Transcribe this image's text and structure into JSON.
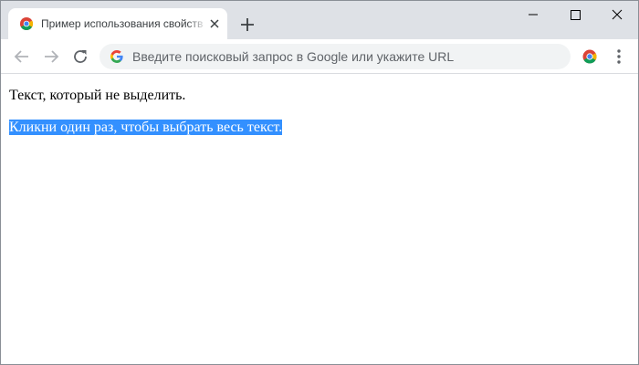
{
  "browser": {
    "tab": {
      "title": "Пример использования свойства user-select",
      "favicon": "chromium-favicon-icon"
    },
    "omnibox": {
      "placeholder": "Введите поисковый запрос в Google или укажите URL"
    },
    "colors": {
      "tabstrip": "#dee1e6",
      "omnibox_bg": "#f1f3f4",
      "selection": "#3390ff"
    }
  },
  "page": {
    "text_unselectable": "Текст, который не выделить.",
    "text_select_all": "Кликни один раз, чтобы выбрать весь текст."
  }
}
